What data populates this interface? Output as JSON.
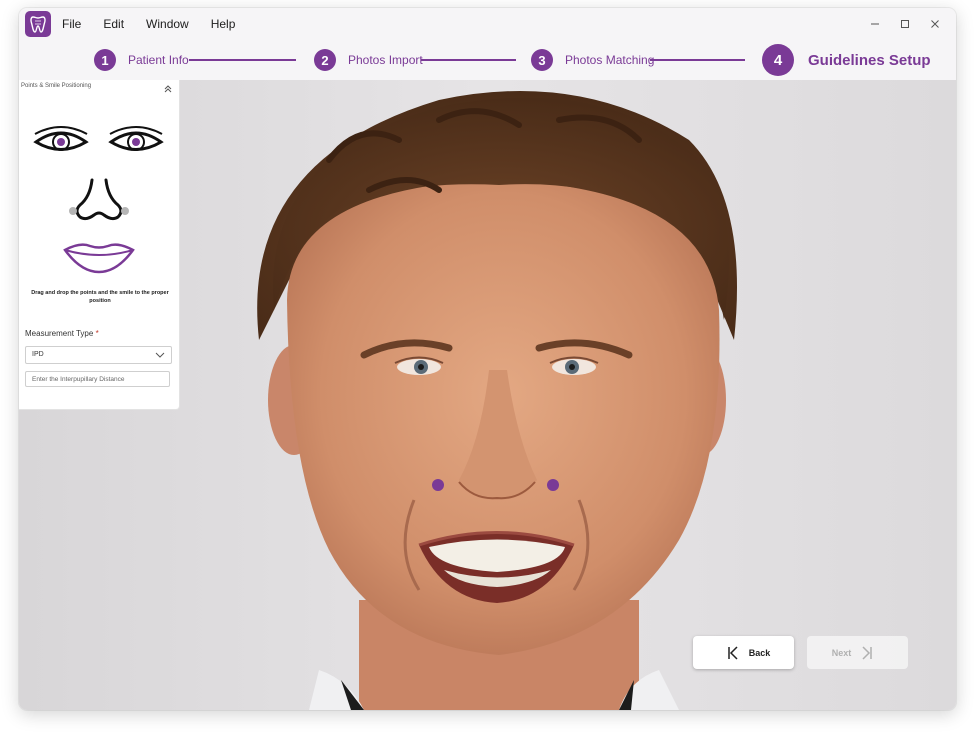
{
  "menu": {
    "items": [
      "File",
      "Edit",
      "Window",
      "Help"
    ]
  },
  "stepper": {
    "steps": [
      {
        "number": "1",
        "label": "Patient Info"
      },
      {
        "number": "2",
        "label": "Photos Import"
      },
      {
        "number": "3",
        "label": "Photos Matching"
      },
      {
        "number": "4",
        "label": "Guidelines Setup"
      }
    ],
    "active_step": 4
  },
  "panel": {
    "title": "Points & Smile Positioning",
    "hint": "Drag and drop the points and the smile to the proper position",
    "measurement_label": "Measurement Type",
    "required_mark": "*",
    "measurement_value": "IPD",
    "ipd_placeholder": "Enter the Interpupillary Distance"
  },
  "buttons": {
    "back": "Back",
    "next": "Next"
  },
  "colors": {
    "accent": "#7a3a96",
    "background": "#f6f5f7"
  }
}
